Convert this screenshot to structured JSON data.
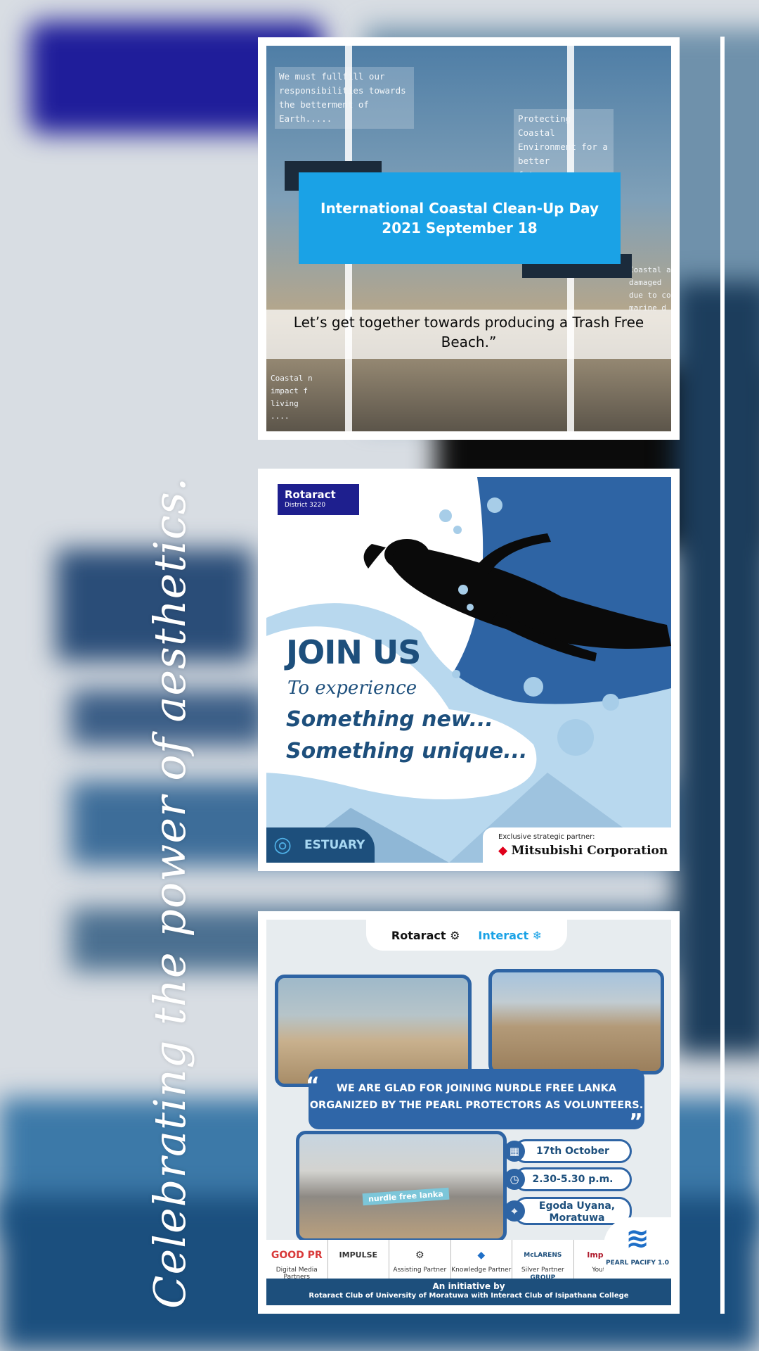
{
  "tagline": "Celebrating the power of aesthetics.",
  "card1": {
    "note_left": "We must fullfill our responsibilities towards the betterment of Earth.....",
    "note_right": "Protecting Coastal Environment for a better future......",
    "note_right_lower": "Coastal a damaged due to co marine d",
    "note_left_lower": "Coastal n impact f living ....",
    "banner_line1": "International Coastal Clean-Up Day",
    "banner_line2": "2021 September 18",
    "trash_line": "Let’s get together towards producing a Trash Free Beach.”"
  },
  "card2": {
    "badge_title": "Rotaract",
    "badge_district": "District 3220",
    "join": "JOIN US",
    "experience": "To experience",
    "line1": "Something new...",
    "line2": "Something unique...",
    "estuary": "ESTUARY",
    "partner_label": "Exclusive strategic partner:",
    "partner_name": "Mitsubishi Corporation"
  },
  "card3": {
    "rotaract": "Rotaract",
    "interact": "Interact",
    "quote": "WE ARE GLAD FOR JOINING NURDLE FREE LANKA ORGANIZED BY THE PEARL PROTECTORS AS VOLUNTEERS.",
    "banner_text": "nurdle free lanka",
    "date": "17th October",
    "time": "2.30-5.30 p.m.",
    "location": "Egoda Uyana, Moratuwa",
    "partners": [
      {
        "logo": "GOOD PR",
        "role": "Digital Media Partners"
      },
      {
        "logo": "IMPULSE",
        "role": ""
      },
      {
        "logo": "⚙",
        "role": "Assisting Partner"
      },
      {
        "logo": "◆",
        "role": "Knowledge Partner"
      },
      {
        "logo": "McLARENS GROUP",
        "role": "Silver Partner"
      },
      {
        "logo": "Imperial College",
        "role": "Youth Spirit Partner"
      }
    ],
    "pearl": "PEARL PACIFY 1.0",
    "initiative_title": "An initiative by",
    "initiative_body": "Rotaract Club of University of Moratuwa with Interact Club of Isipathana College"
  },
  "colors": {
    "accent_blue": "#1aa2e6",
    "navy": "#1d4f7c",
    "mitsubishi_red": "#e0001b"
  }
}
